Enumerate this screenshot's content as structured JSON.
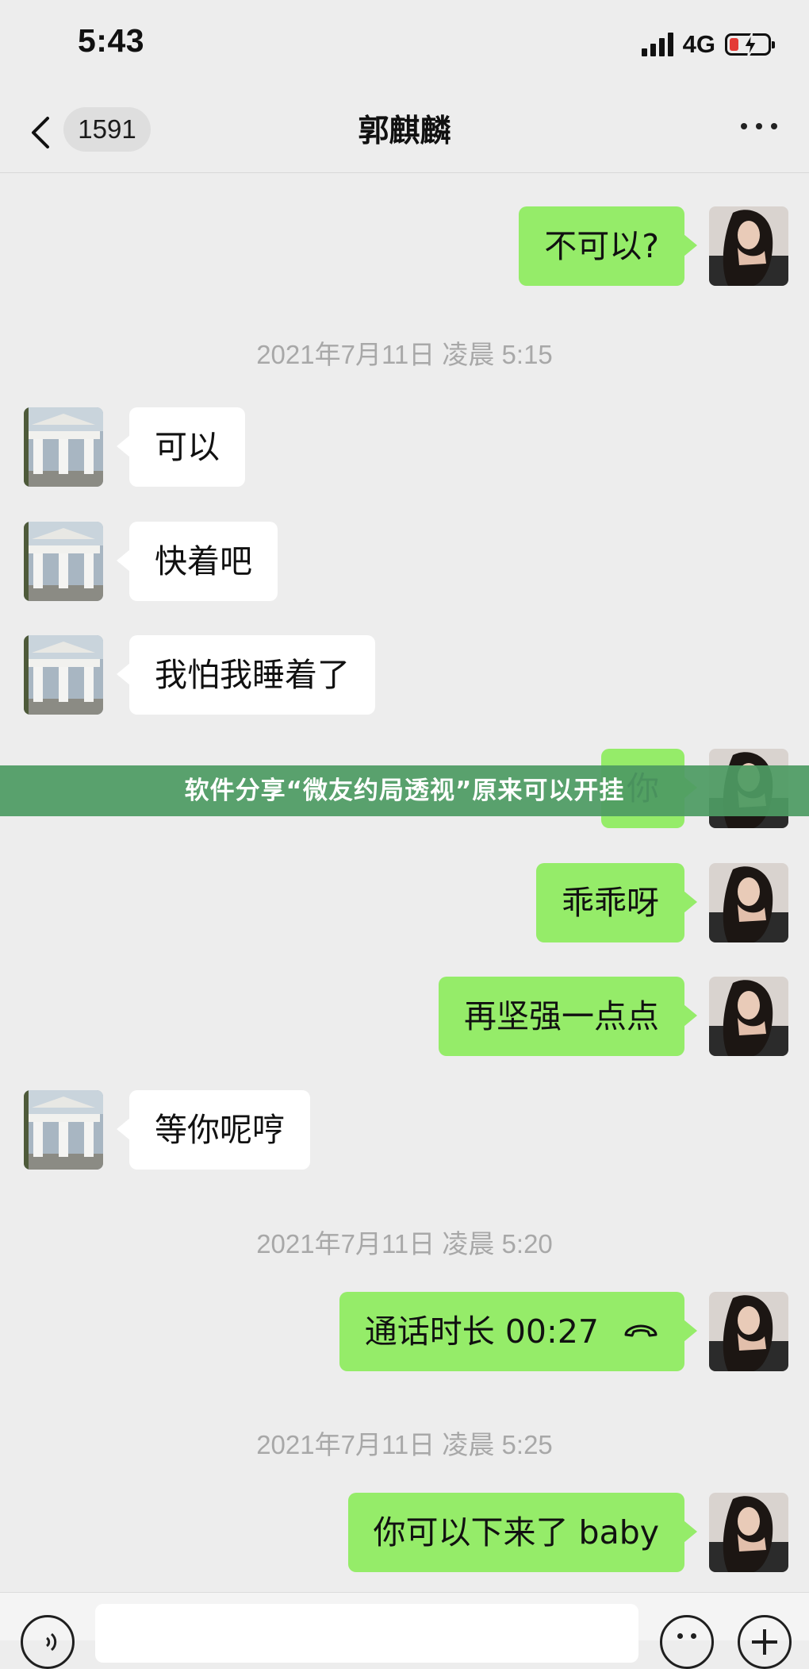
{
  "status_bar": {
    "time": "5:43",
    "network": "4G"
  },
  "nav": {
    "unread_count": "1591",
    "title": "郭麒麟"
  },
  "banner": {
    "text": "软件分享“微友约局透视”原来可以开挂"
  },
  "messages": [
    {
      "side": "mine",
      "text": "不可以?"
    },
    {
      "type": "timestamp",
      "text": "2021年7月11日 凌晨 5:15"
    },
    {
      "side": "theirs",
      "text": "可以"
    },
    {
      "side": "theirs",
      "text": "快着吧"
    },
    {
      "side": "theirs",
      "text": "我怕我睡着了"
    },
    {
      "side": "mine",
      "text": "你"
    },
    {
      "side": "mine",
      "text": "乖乖呀"
    },
    {
      "side": "mine",
      "text": "再坚强一点点"
    },
    {
      "side": "theirs",
      "text": "等你呢哼"
    },
    {
      "type": "timestamp",
      "text": "2021年7月11日 凌晨 5:20"
    },
    {
      "side": "mine",
      "text": "通话时长 00:27",
      "icon": "phone-hangup-icon"
    },
    {
      "type": "timestamp",
      "text": "2021年7月11日 凌晨 5:25"
    },
    {
      "side": "mine",
      "text": "你可以下来了 baby"
    }
  ],
  "colors": {
    "background": "#ededed",
    "mine_bubble": "#95ec69",
    "theirs_bubble": "#ffffff",
    "banner": "#4e9b63",
    "battery_low": "#e43b36"
  },
  "icons": [
    "back-chevron-icon",
    "more-icon",
    "signal-icon",
    "battery-icon",
    "voice-icon",
    "emoji-icon",
    "plus-icon"
  ]
}
